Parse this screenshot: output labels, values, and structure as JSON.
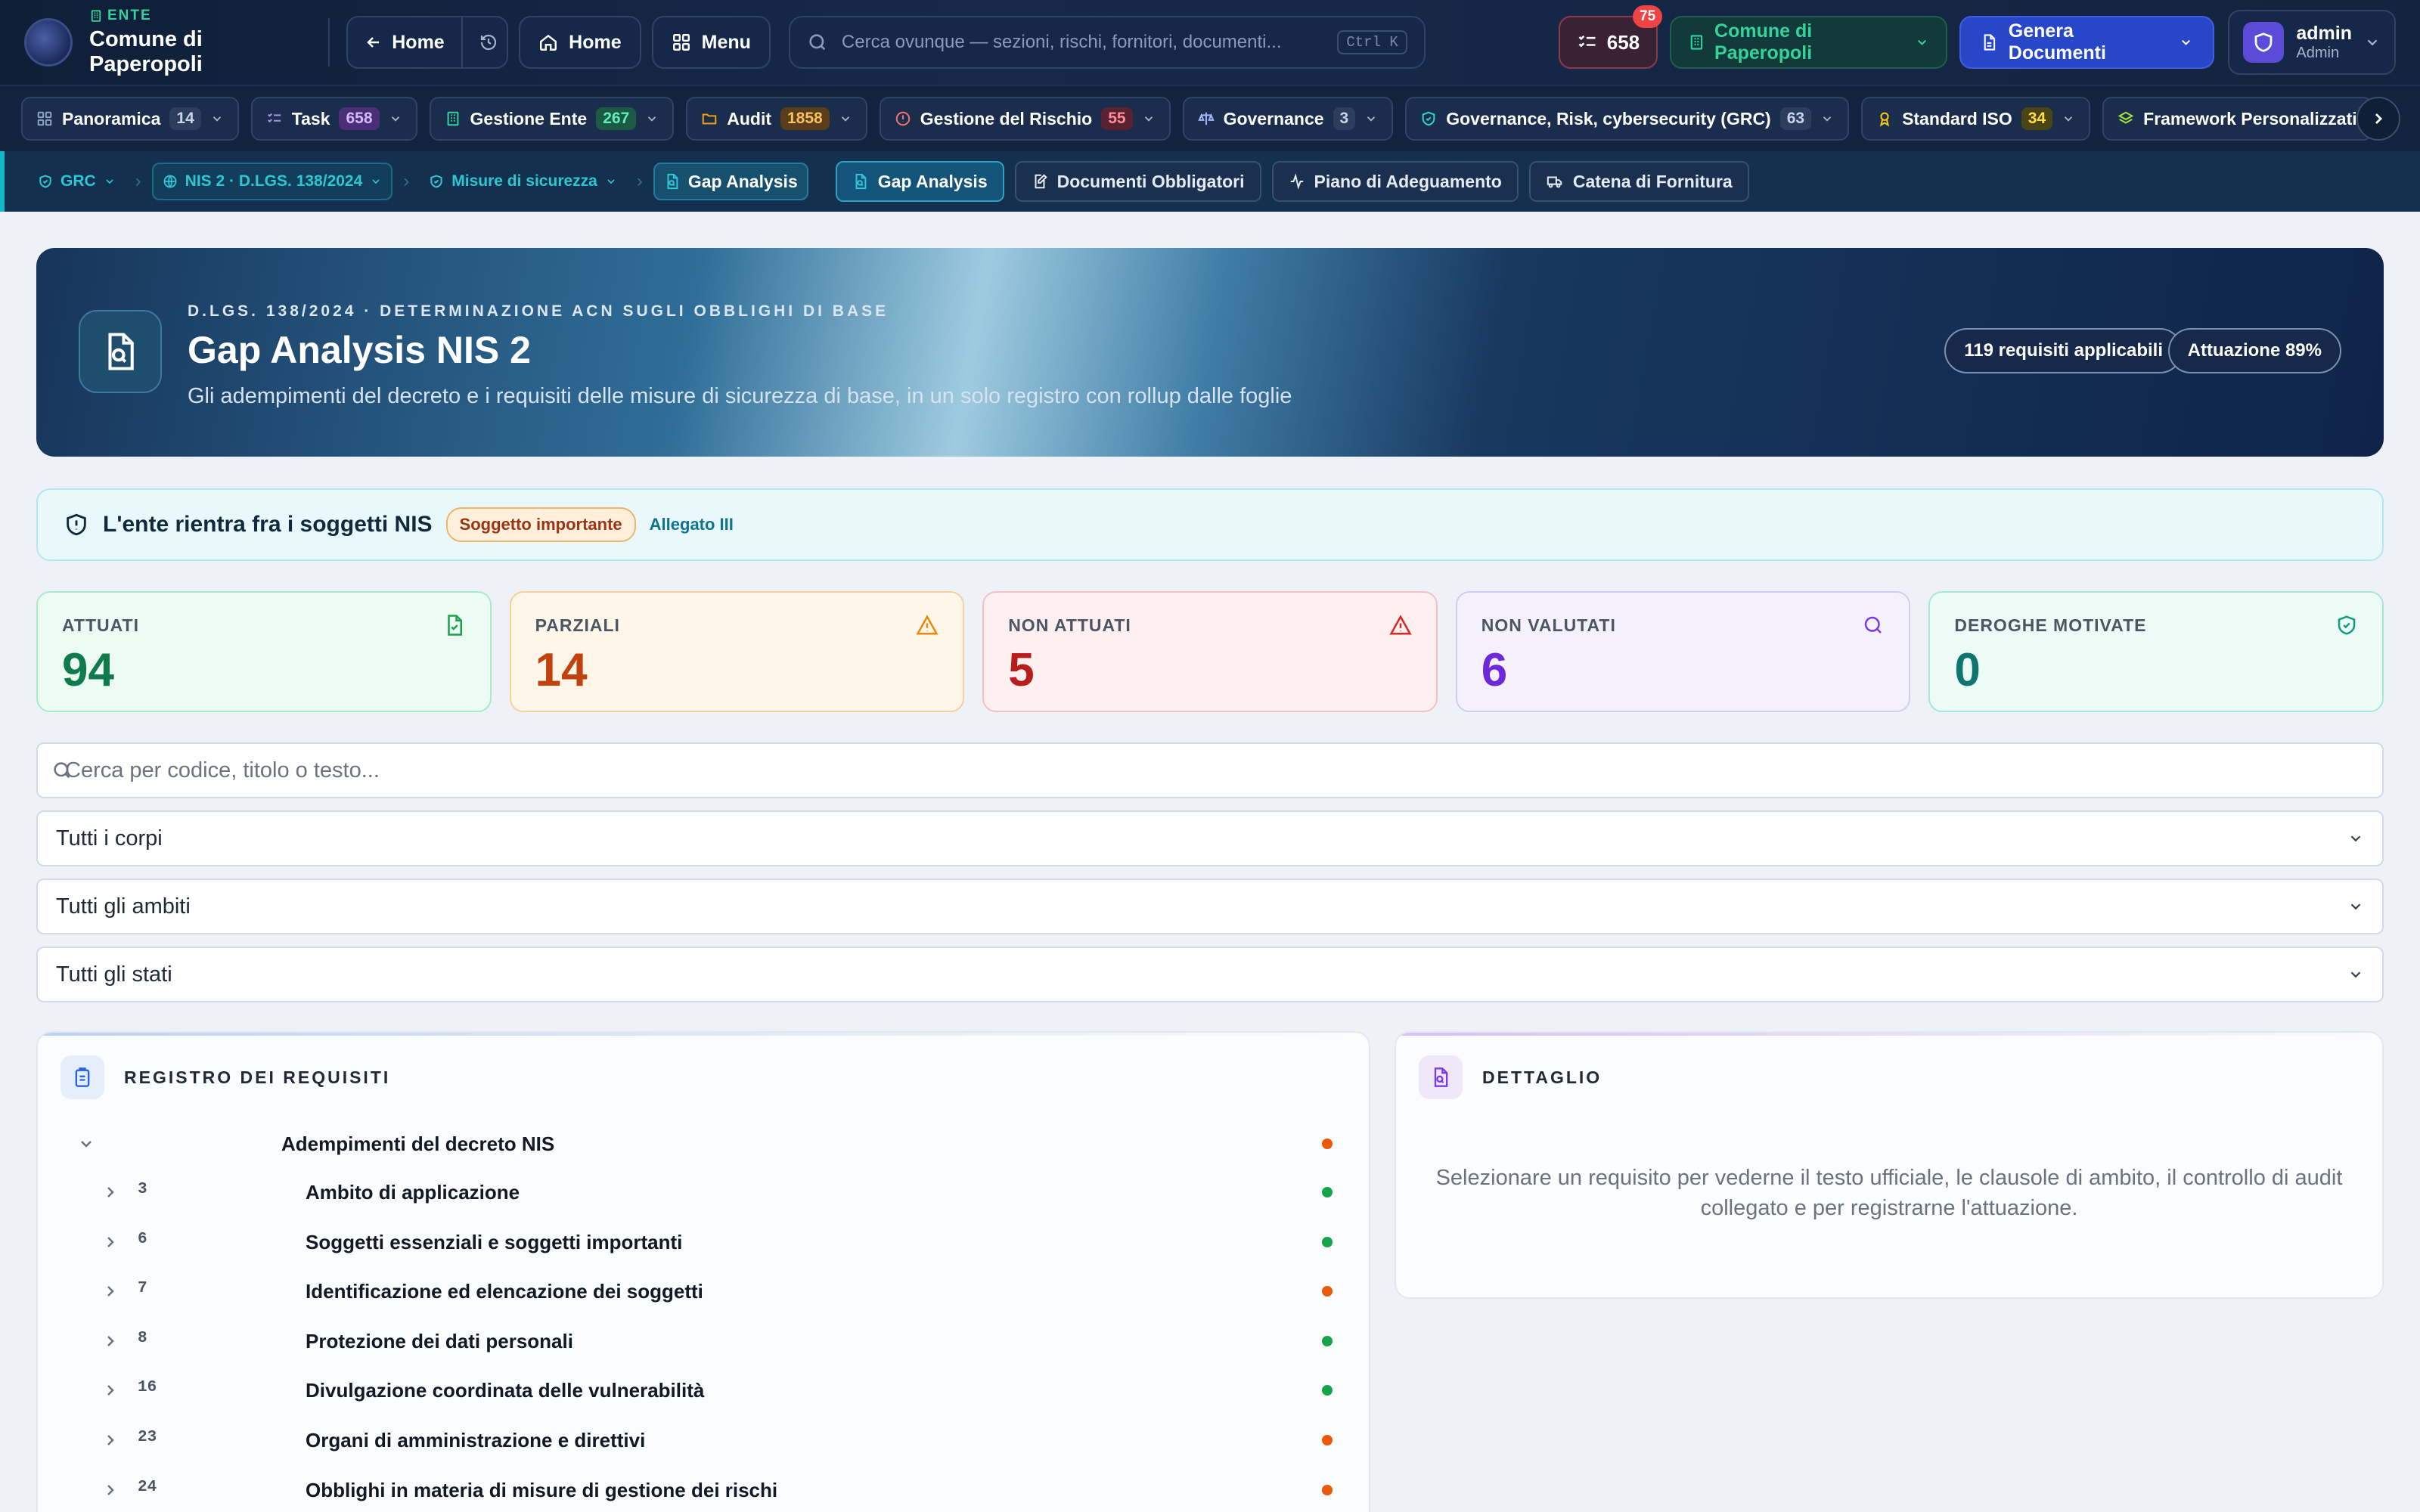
{
  "topbar": {
    "ente_tag": "ENTE",
    "ente_name": "Comune di Paperopoli",
    "back_label": "Home",
    "home_label": "Home",
    "menu_label": "Menu",
    "search_placeholder": "Cerca ovunque — sezioni, rischi, fornitori, documenti...",
    "search_shortcut": "Ctrl K",
    "tasks_count": "658",
    "tasks_badge": "75",
    "comune_label": "Comune di Paperopoli",
    "genera_label": "Genera Documenti",
    "user_name": "admin",
    "user_role": "Admin"
  },
  "modules": [
    {
      "label": "Panoramica",
      "count": "14",
      "icon": "grid-icon",
      "color": "#8fa3c4",
      "count_bg": "#2b3e5e",
      "count_fg": "#c9d4e6"
    },
    {
      "label": "Task",
      "count": "658",
      "icon": "tasks-icon",
      "color": "#b48af0",
      "count_bg": "#4a2f78",
      "count_fg": "#d6b9ff"
    },
    {
      "label": "Gestione Ente",
      "count": "267",
      "icon": "building-icon",
      "color": "#34d399",
      "count_bg": "#1c5a45",
      "count_fg": "#5ef0b5"
    },
    {
      "label": "Audit",
      "count": "1858",
      "icon": "folder-icon",
      "color": "#f59e0b",
      "count_bg": "#5a3e1c",
      "count_fg": "#fbbf5e"
    },
    {
      "label": "Gestione del Rischio",
      "count": "55",
      "icon": "alert-icon",
      "color": "#f87171",
      "count_bg": "#5a2230",
      "count_fg": "#ff8a9a"
    },
    {
      "label": "Governance",
      "count": "3",
      "icon": "scale-icon",
      "color": "#a5b4fc",
      "count_bg": "#2b3e5e",
      "count_fg": "#c9d4e6"
    },
    {
      "label": "Governance, Risk, cybersecurity (GRC)",
      "count": "63",
      "icon": "shield-icon",
      "color": "#2dd4bf",
      "count_bg": "#2b3e5e",
      "count_fg": "#c9d4e6"
    },
    {
      "label": "Standard ISO",
      "count": "34",
      "icon": "award-icon",
      "color": "#facc15",
      "count_bg": "#4a4416",
      "count_fg": "#fde047"
    },
    {
      "label": "Framework Personalizzati",
      "count": "",
      "icon": "layers-icon",
      "color": "#a3e635",
      "count_bg": "",
      "count_fg": ""
    }
  ],
  "breadcrumb": {
    "grc": "GRC",
    "nis": "NIS 2 · D.LGS. 138/2024",
    "misure": "Misure di sicurezza",
    "current": "Gap Analysis"
  },
  "subtabs": [
    "Gap Analysis",
    "Documenti Obbligatori",
    "Piano di Adeguamento",
    "Catena di Fornitura"
  ],
  "hero": {
    "eyebrow": "D.LGS. 138/2024 · DETERMINAZIONE ACN SUGLI OBBLIGHI DI BASE",
    "title": "Gap Analysis NIS 2",
    "subtitle": "Gli adempimenti del decreto e i requisiti delle misure di sicurezza di base, in un solo registro con rollup dalle foglie",
    "pill_requisiti": "119 requisiti applicabili",
    "pill_attuazione": "Attuazione 89%"
  },
  "nis_status": {
    "title": "L'ente rientra fra i soggetti NIS",
    "badge": "Soggetto importante",
    "link": "Allegato III"
  },
  "stats": [
    {
      "label": "ATTUATI",
      "value": "94"
    },
    {
      "label": "PARZIALI",
      "value": "14"
    },
    {
      "label": "NON ATTUATI",
      "value": "5"
    },
    {
      "label": "NON VALUTATI",
      "value": "6"
    },
    {
      "label": "DEROGHE MOTIVATE",
      "value": "0"
    }
  ],
  "filters": {
    "search_placeholder": "Cerca per codice, titolo o testo...",
    "corpi": "Tutti i corpi",
    "ambiti": "Tutti gli ambiti",
    "stati": "Tutti gli stati"
  },
  "registro": {
    "title": "REGISTRO DEI REQUISITI",
    "root": {
      "title": "Adempimenti del decreto NIS",
      "status": "orange"
    },
    "items": [
      {
        "code": "3",
        "title": "Ambito di applicazione",
        "status": "green"
      },
      {
        "code": "6",
        "title": "Soggetti essenziali e soggetti importanti",
        "status": "green"
      },
      {
        "code": "7",
        "title": "Identificazione ed elencazione dei soggetti",
        "status": "orange"
      },
      {
        "code": "8",
        "title": "Protezione dei dati personali",
        "status": "green"
      },
      {
        "code": "16",
        "title": "Divulgazione coordinata delle vulnerabilità",
        "status": "green"
      },
      {
        "code": "23",
        "title": "Organi di amministrazione e direttivi",
        "status": "orange"
      },
      {
        "code": "24",
        "title": "Obblighi in materia di misure di gestione dei rischi",
        "status": "orange"
      }
    ]
  },
  "dettaglio": {
    "title": "DETTAGLIO",
    "text": "Selezionare un requisito per vederne il testo ufficiale, le clausole di ambito, il controllo di audit collegato e per registrarne l'attuazione."
  },
  "colors": {
    "status_green": "#16a34a",
    "status_orange": "#ea580c",
    "accent": "#14b8c4"
  }
}
